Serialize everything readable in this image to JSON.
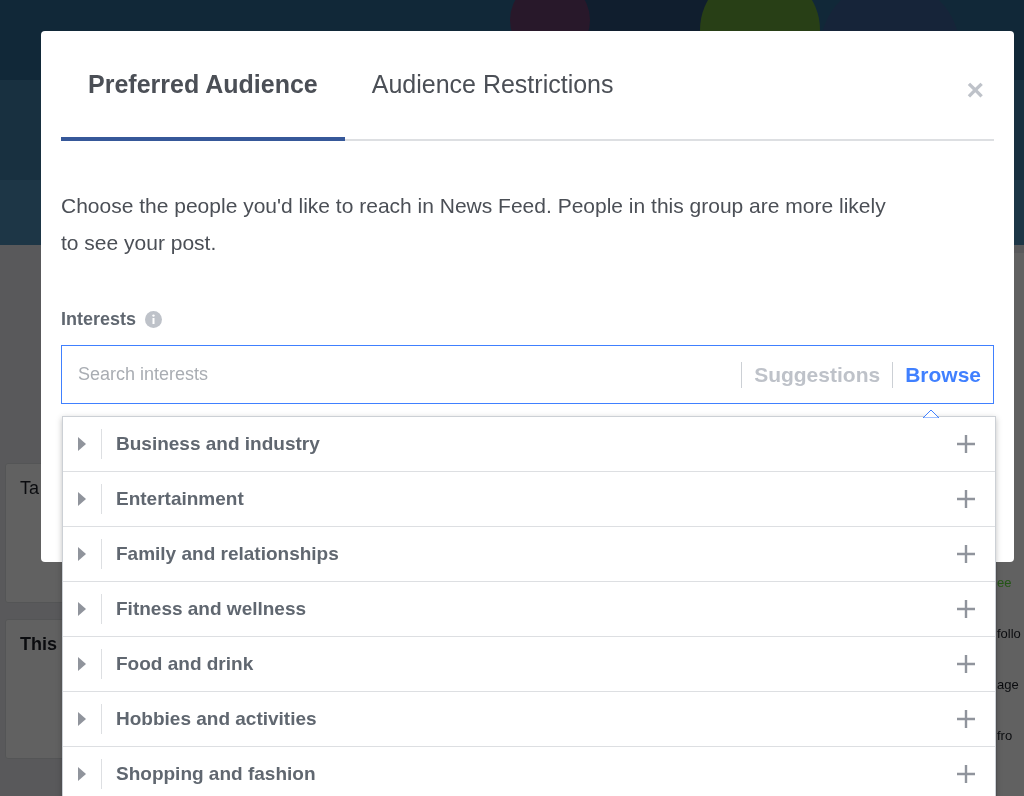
{
  "background": {
    "left_fragments": [
      "Ta",
      "This"
    ],
    "right_fragments": [
      "ee",
      "follo",
      "age",
      "fro"
    ]
  },
  "dialog": {
    "tabs": [
      {
        "label": "Preferred Audience",
        "selected": true
      },
      {
        "label": "Audience Restrictions",
        "selected": false
      }
    ],
    "close": "×",
    "description": "Choose the people you'd like to reach in News Feed. People in this group are more likely to see your post.",
    "interests": {
      "label": "Interests",
      "search": {
        "placeholder": "Search interests"
      },
      "modes": [
        {
          "label": "Suggestions",
          "selected": false
        },
        {
          "label": "Browse",
          "selected": true
        }
      ],
      "categories": [
        {
          "label": "Business and industry"
        },
        {
          "label": "Entertainment"
        },
        {
          "label": "Family and relationships"
        },
        {
          "label": "Fitness and wellness"
        },
        {
          "label": "Food and drink"
        },
        {
          "label": "Hobbies and activities"
        },
        {
          "label": "Shopping and fashion"
        }
      ]
    }
  }
}
